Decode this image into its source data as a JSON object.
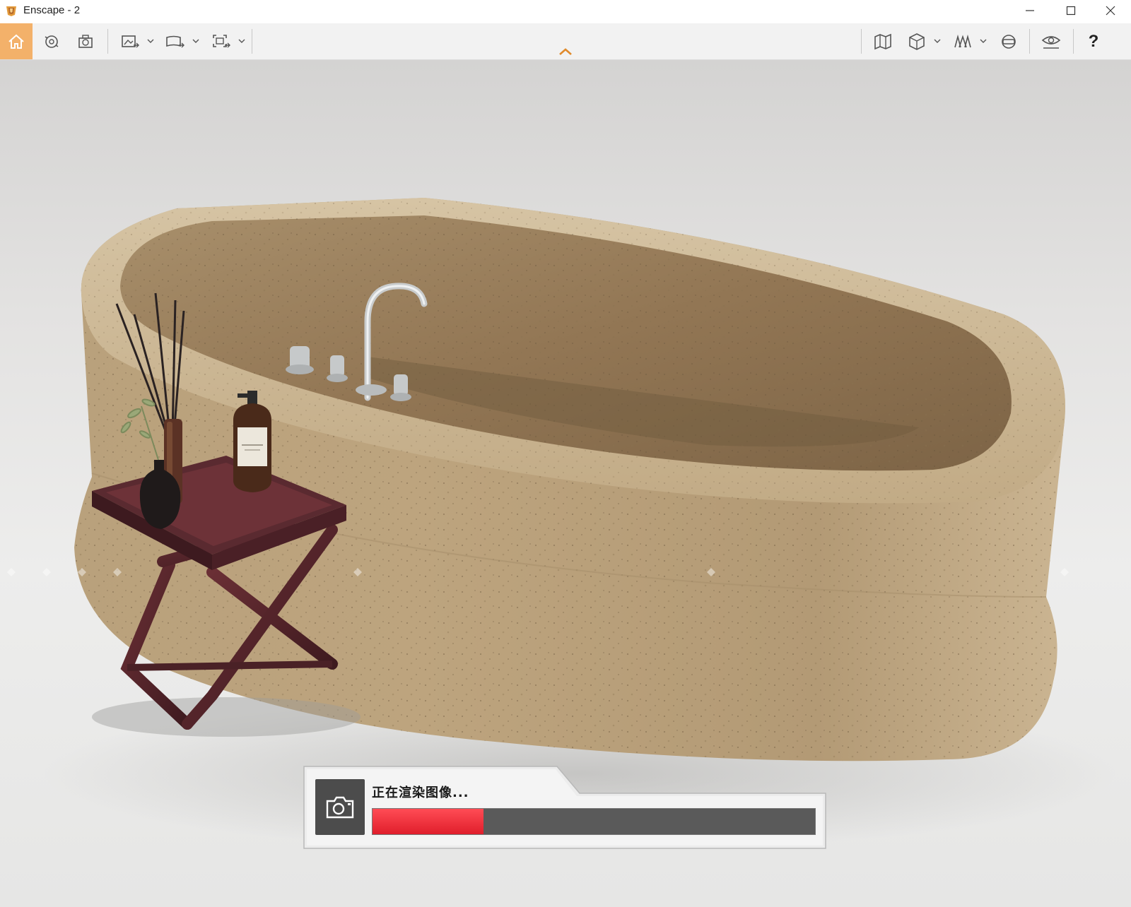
{
  "window": {
    "title": "Enscape - 2"
  },
  "toolbar": {
    "help_label": "?"
  },
  "render_status": {
    "label": "正在渲染图像...",
    "progress": 0.25,
    "progress_color": "#e8202c"
  },
  "colors": {
    "home_active": "#f3b16a",
    "accent": "#e08a2c"
  }
}
